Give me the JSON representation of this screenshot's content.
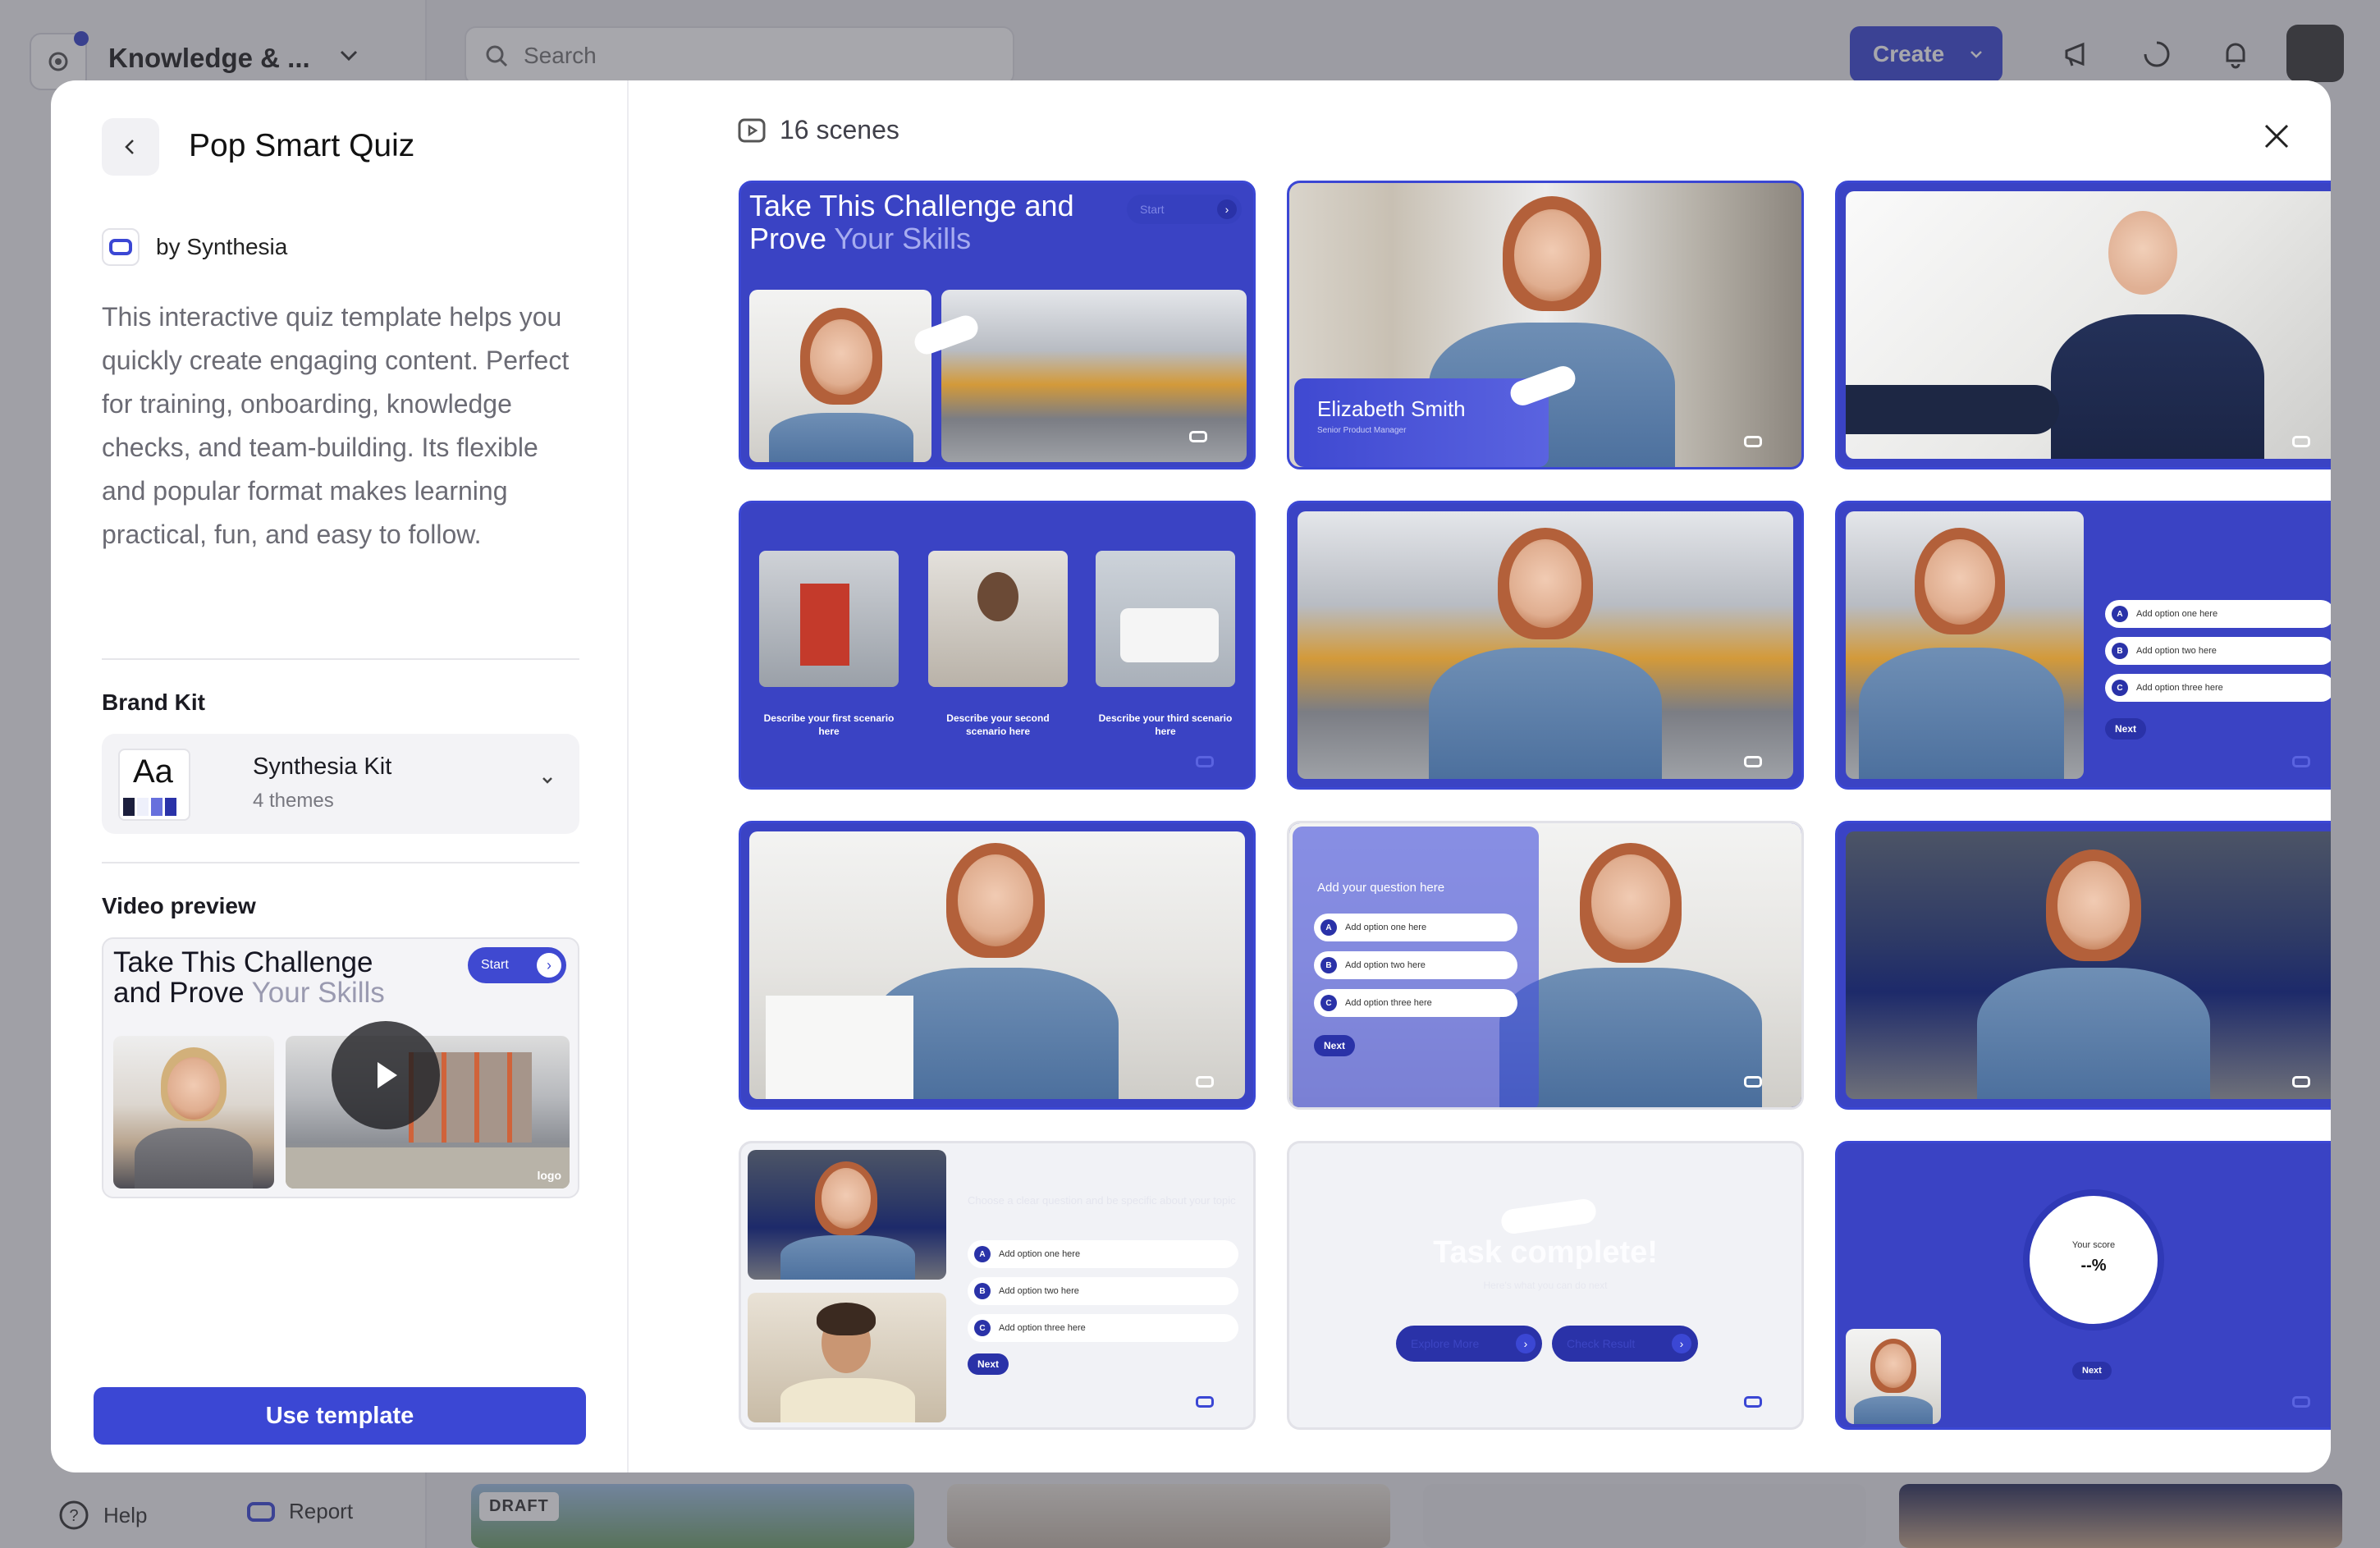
{
  "workspace": {
    "name": "Knowledge & ..."
  },
  "search": {
    "placeholder": "Search"
  },
  "header": {
    "create_label": "Create"
  },
  "footer": {
    "help": "Help",
    "report": "Report",
    "draft": "DRAFT"
  },
  "modal": {
    "title": "Pop Smart Quiz",
    "author": "by Synthesia",
    "description": "This interactive quiz template helps you quickly create engaging content. Perfect for training, onboarding, knowledge checks, and team-building. Its flexible and popular format makes learning practical, fun, and easy to follow.",
    "brand_kit_label": "Brand Kit",
    "brand_kit": {
      "aa": "Aa",
      "name": "Synthesia Kit",
      "themes": "4 themes"
    },
    "video_preview_label": "Video preview",
    "preview": {
      "title_line1": "Take This Challenge",
      "title_line2a": "and Prove ",
      "title_line2b": "Your Skills",
      "start": "Start",
      "logo": "logo"
    },
    "use_template": "Use template",
    "scenes_count": "16 scenes"
  },
  "scenes": {
    "s1": {
      "title_a": "Take This Challenge and",
      "title_b": "Prove ",
      "title_c": "Your Skills",
      "start": "Start"
    },
    "s2": {
      "name": "Elizabeth Smith",
      "role": "Senior Product Manager"
    },
    "s4": {
      "cap1": "Describe your first scenario here",
      "cap2": "Describe your second scenario here",
      "cap3": "Describe your third scenario here"
    },
    "s6": {
      "opt_a": "Add option one here",
      "opt_b": "Add option two here",
      "opt_c": "Add option three here",
      "next": "Next"
    },
    "s8": {
      "question": "Add your question here",
      "opt_a": "Add option one here",
      "opt_b": "Add option two here",
      "opt_c": "Add option three here",
      "next": "Next"
    },
    "s10": {
      "question": "Choose a clear question and be specific about your topic",
      "opt_a": "Add option one here",
      "opt_b": "Add option two here",
      "opt_c": "Add option three here",
      "next": "Next"
    },
    "s11": {
      "title": "Task complete!",
      "subtitle": "Here's what you can do next",
      "btn1": "Explore More",
      "btn2": "Check Result"
    },
    "s12": {
      "score_label": "Your score",
      "score_value": "--%",
      "next": "Next"
    }
  },
  "colors": {
    "brand": "#3b47d4",
    "scene_blue": "#3a43c4",
    "dark_blue": "#2a32a8"
  }
}
